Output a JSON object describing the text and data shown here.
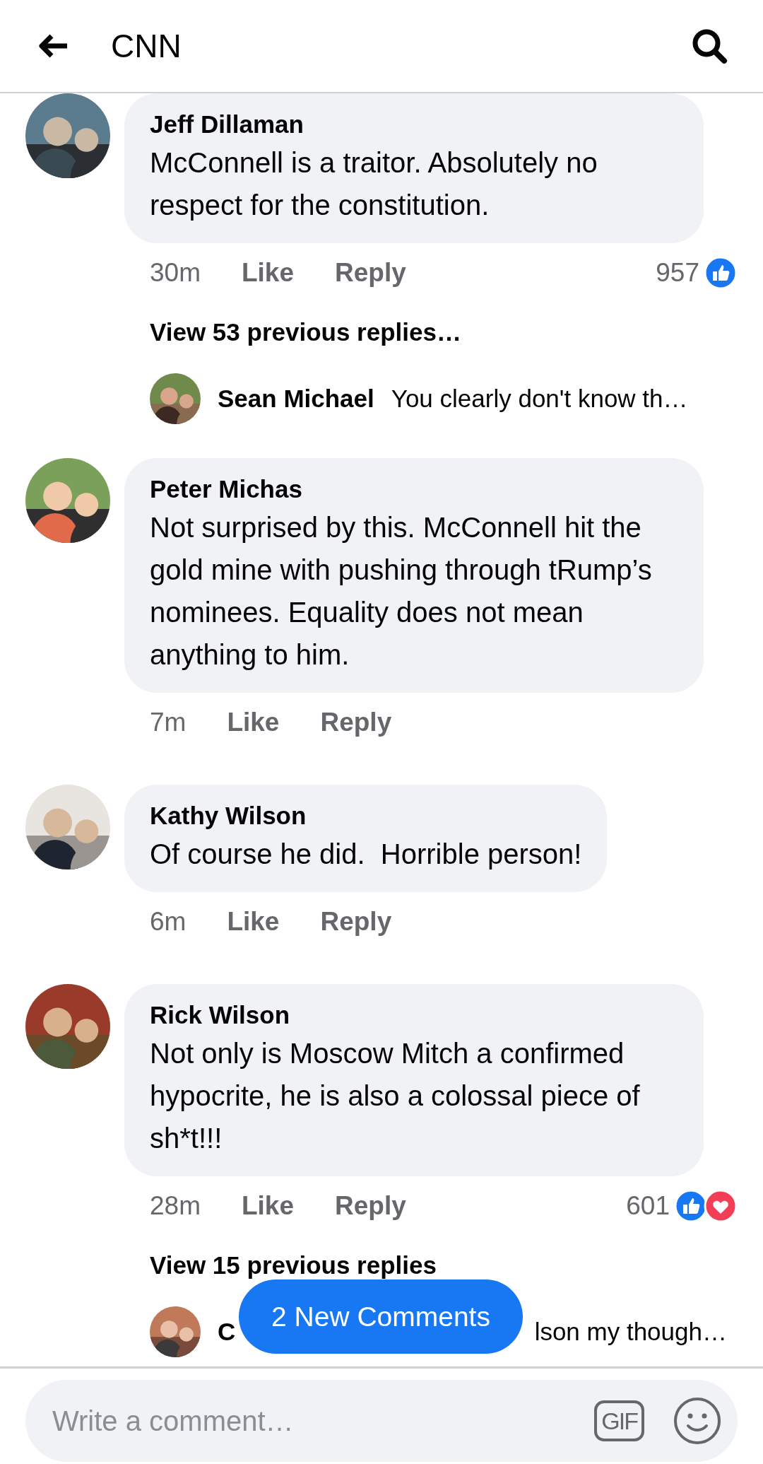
{
  "header": {
    "title": "CNN"
  },
  "comments": [
    {
      "author": "Jeff Dillaman",
      "text": "McConnell is a traitor. Absolutely no respect for the constitution.",
      "time": "30m",
      "like": "Like",
      "reply": "Reply",
      "reaction_count": "957",
      "reactions": [
        {
          "kind": "like"
        }
      ],
      "view_replies": "View 53 previous replies…",
      "latest_reply": {
        "author": "Sean Michael",
        "text": "You clearly don't know th…"
      }
    },
    {
      "author": "Peter Michas",
      "text": "Not surprised by this. McConnell hit the gold mine with pushing through tRump’s nominees. Equality does not mean anything to him.",
      "time": "7m",
      "like": "Like",
      "reply": "Reply"
    },
    {
      "author": "Kathy Wilson",
      "text": "Of course he did.  Horrible person!",
      "time": "6m",
      "like": "Like",
      "reply": "Reply"
    },
    {
      "author": "Rick Wilson",
      "text": "Not only is Moscow Mitch a confirmed hypocrite, he is also a colossal piece of sh*t!!!",
      "time": "28m",
      "like": "Like",
      "reply": "Reply",
      "reaction_count": "601",
      "reactions": [
        {
          "kind": "like"
        },
        {
          "kind": "love"
        }
      ],
      "view_replies": "View 15 previous replies",
      "latest_reply": {
        "author": "C",
        "text": "lson my though…"
      }
    }
  ],
  "new_comments_button": "2 New Comments",
  "composer": {
    "placeholder": "Write a comment…",
    "gif": "GIF"
  }
}
